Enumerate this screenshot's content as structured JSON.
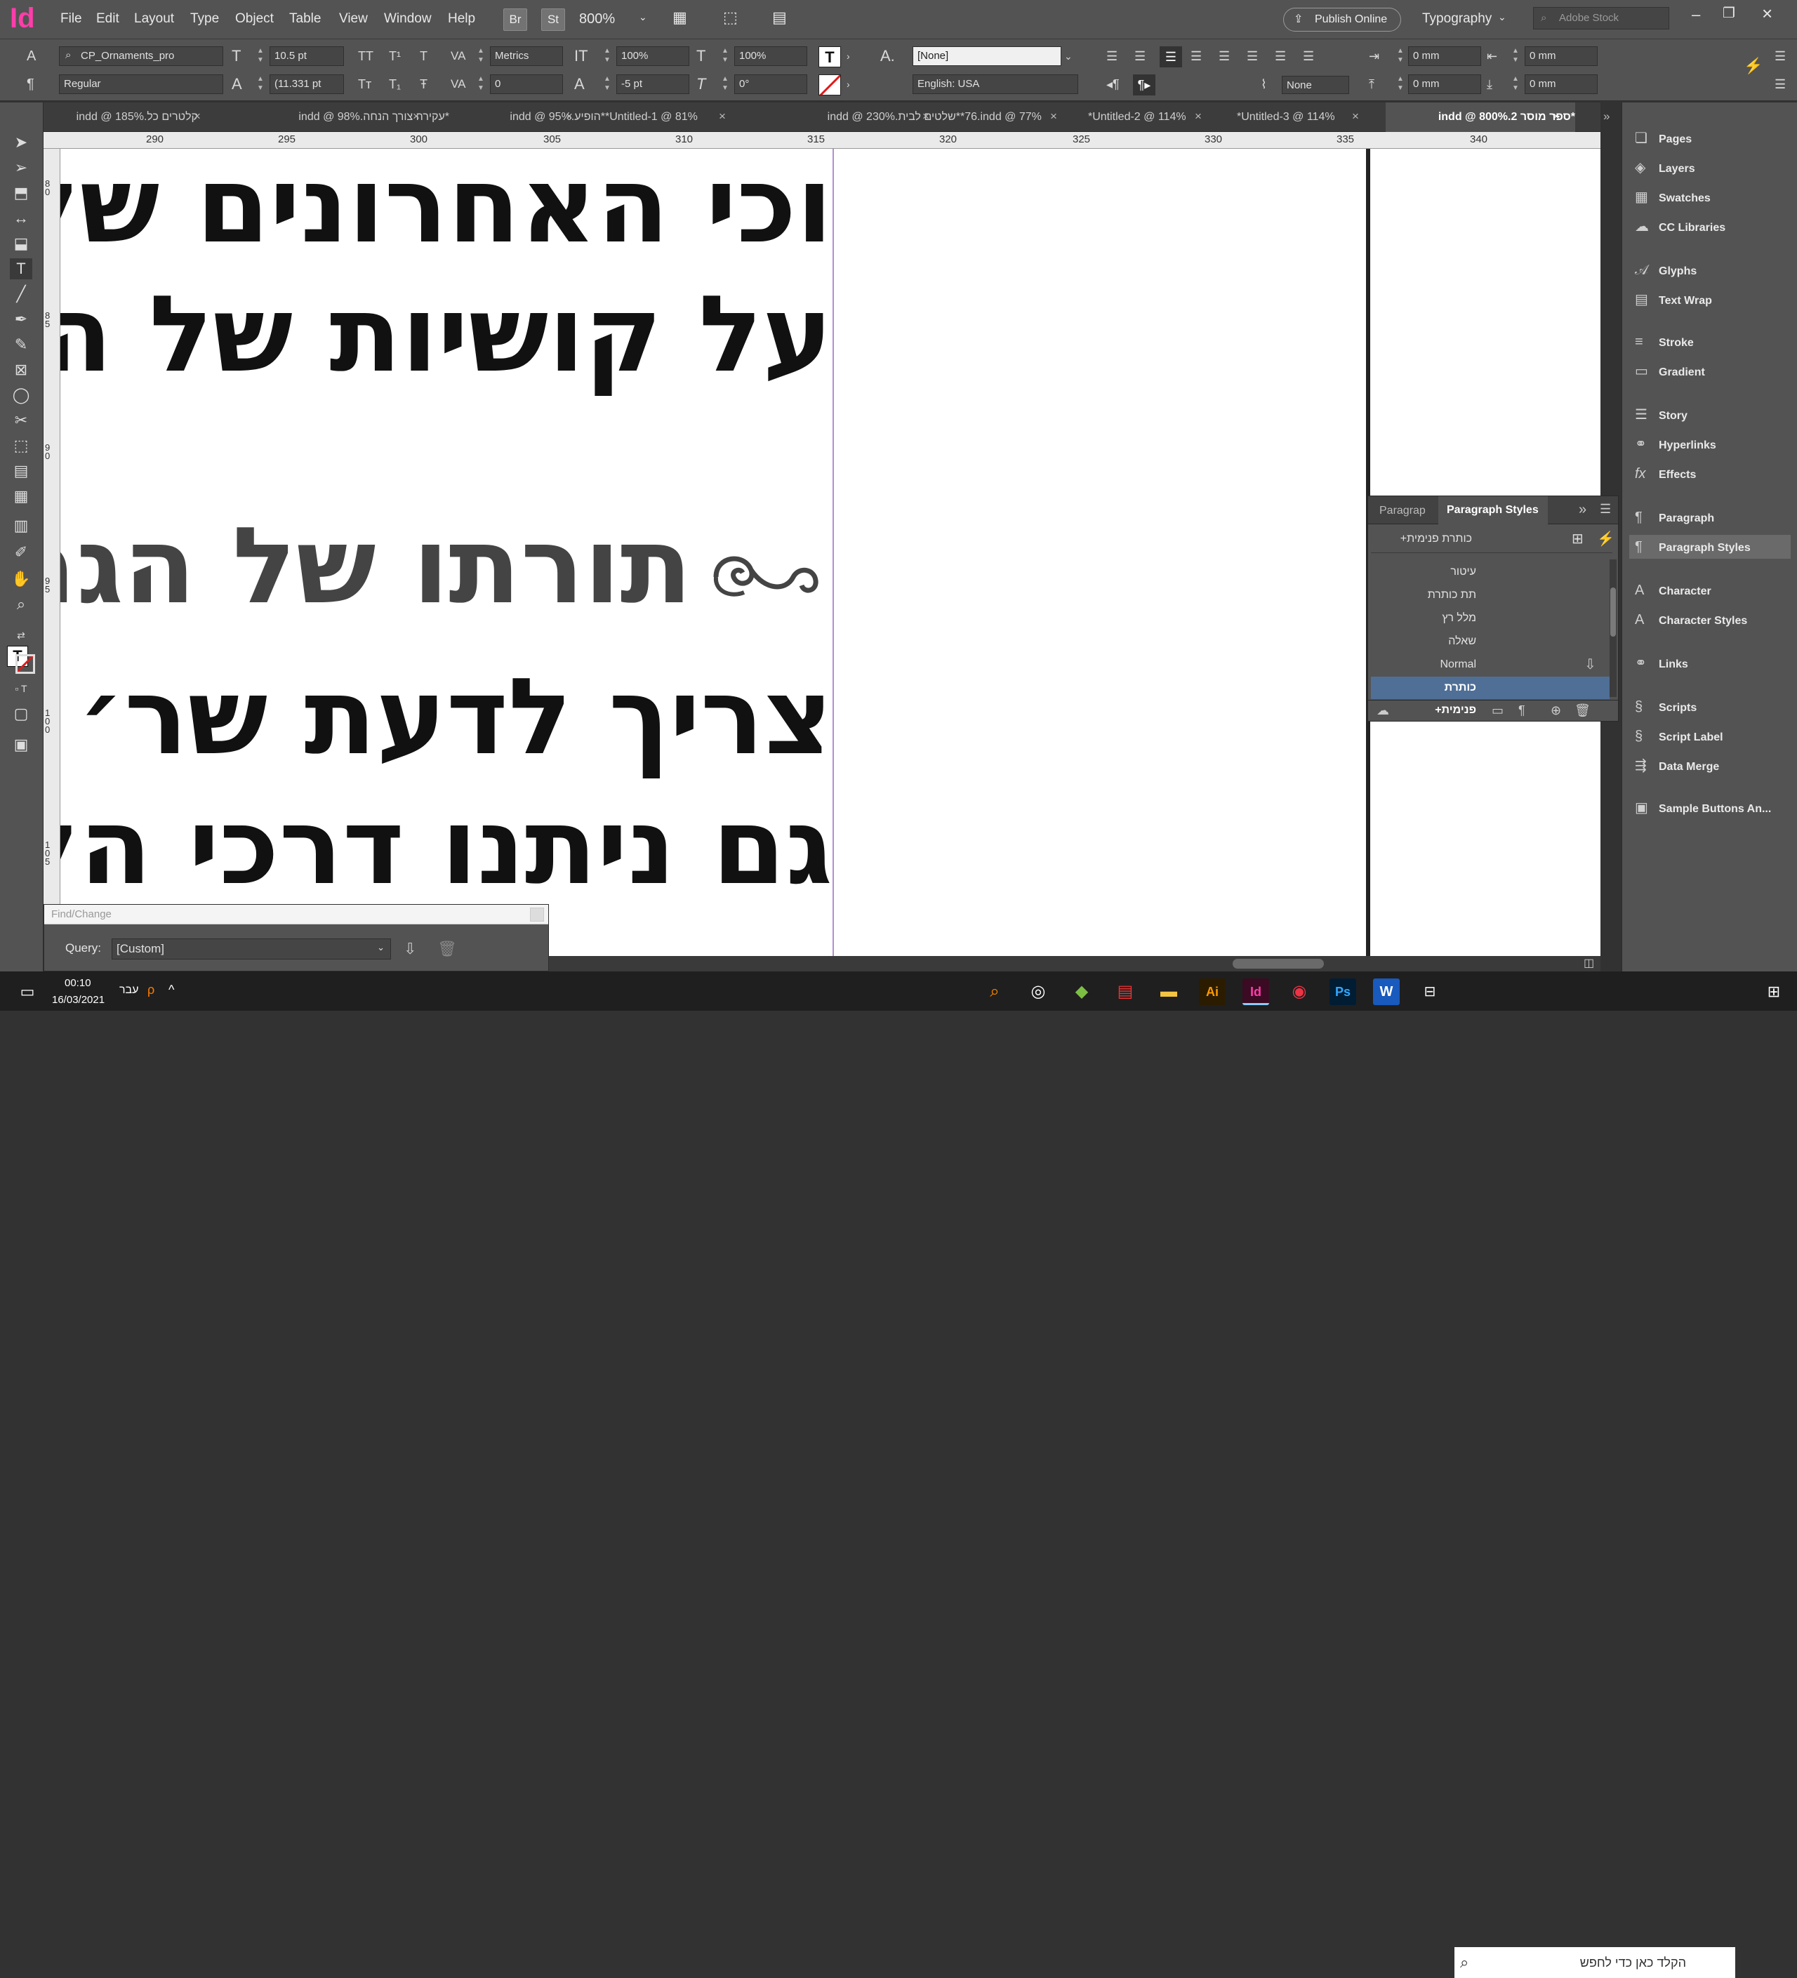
{
  "app": {
    "logo": "Id"
  },
  "menu": [
    "File",
    "Edit",
    "Layout",
    "Type",
    "Object",
    "Table",
    "View",
    "Window",
    "Help"
  ],
  "menubar": {
    "br_label": "Br",
    "st_label": "St",
    "zoom": "800%",
    "publish": "Publish Online",
    "workspace": "Typography",
    "search_placeholder": "Adobe Stock"
  },
  "control": {
    "font_family": "CP_Ornaments_pro",
    "font_style": "Regular",
    "font_size": "10.5 pt",
    "leading": "(11.331 pt",
    "kerning": "Metrics",
    "tracking": "0",
    "vscale": "100%",
    "hscale": "100%",
    "baseline": "-5 pt",
    "skew": "0°",
    "char_style": "[None]",
    "language": "English: USA",
    "hyphen_none": "None",
    "indent_left": "0 mm",
    "indent_right": "0 mm",
    "space_before": "0 mm",
    "space_after": "0 mm"
  },
  "tabs": [
    {
      "label": "קלטרים כל.indd @ 185%"
    },
    {
      "label": "*עקירה צורך הנחה.indd @ 98%"
    },
    {
      "label": "*הופיע.indd @ 95%"
    },
    {
      "label": "*Untitled-1 @ 81%"
    },
    {
      "label": "*שלטים לבית.indd @ 230%"
    },
    {
      "label": "*76.indd @ 77%"
    },
    {
      "label": "*Untitled-2 @ 114%"
    },
    {
      "label": "*Untitled-3 @ 114%"
    },
    {
      "label": "*ספר מוסר 2.indd @ 800%",
      "active": true
    }
  ],
  "ruler": {
    "top": [
      "290",
      "295",
      "300",
      "305",
      "310",
      "315",
      "320",
      "325",
      "330",
      "335",
      "340"
    ],
    "left": [
      "80",
      "85",
      "90",
      "95",
      "100",
      "105"
    ]
  },
  "document": {
    "lines": [
      "וכי האחרונים שלפנ",
      "על קושיות של הרא",
      "תורתו של הגר״",
      "צריך לדעת שר׳ בו",
      "גם ניתנו דרכי הלי"
    ],
    "ornament": "ornament-swirl"
  },
  "find_change": {
    "title": "Find/Change",
    "query_label": "Query:",
    "query_value": "[Custom]"
  },
  "paragraph_styles": {
    "tab_paragraph": "Paragrap",
    "tab_styles": "Paragraph Styles",
    "current": "כותרת פנימית+",
    "items": [
      {
        "label": "עיטור"
      },
      {
        "label": "תת כותרת"
      },
      {
        "label": "מלל רץ"
      },
      {
        "label": "שאלה"
      },
      {
        "label": "Normal"
      },
      {
        "label": "כותרת פנימית+",
        "selected": true
      }
    ]
  },
  "right_panel": [
    {
      "label": "Pages",
      "icon": "pages-icon"
    },
    {
      "label": "Layers",
      "icon": "layers-icon"
    },
    {
      "label": "Swatches",
      "icon": "swatches-icon"
    },
    {
      "label": "CC Libraries",
      "icon": "cc-libraries-icon"
    },
    {
      "label": "Glyphs",
      "icon": "glyphs-icon"
    },
    {
      "label": "Text Wrap",
      "icon": "text-wrap-icon"
    },
    {
      "label": "Stroke",
      "icon": "stroke-icon"
    },
    {
      "label": "Gradient",
      "icon": "gradient-icon"
    },
    {
      "label": "Story",
      "icon": "story-icon"
    },
    {
      "label": "Hyperlinks",
      "icon": "hyperlinks-icon"
    },
    {
      "label": "Effects",
      "icon": "effects-icon"
    },
    {
      "label": "Paragraph",
      "icon": "paragraph-icon"
    },
    {
      "label": "Paragraph Styles",
      "icon": "paragraph-styles-icon",
      "selected": true
    },
    {
      "label": "Character",
      "icon": "character-icon"
    },
    {
      "label": "Character Styles",
      "icon": "character-styles-icon"
    },
    {
      "label": "Links",
      "icon": "links-icon"
    },
    {
      "label": "Scripts",
      "icon": "scripts-icon"
    },
    {
      "label": "Script Label",
      "icon": "script-label-icon"
    },
    {
      "label": "Data Merge",
      "icon": "data-merge-icon"
    },
    {
      "label": "Sample Buttons An...",
      "icon": "sample-buttons-icon"
    }
  ],
  "taskbar": {
    "time": "00:10",
    "date": "16/03/2021",
    "lang": "עבר",
    "search_placeholder": "הקלד כאן כדי לחפש"
  }
}
